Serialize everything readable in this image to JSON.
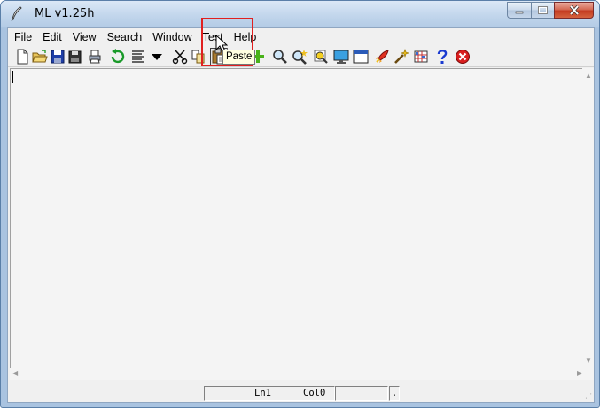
{
  "window": {
    "title": "ML v1.25h",
    "controls": {
      "minimize": "minimize-icon",
      "maximize": "maximize-icon",
      "close": "close-icon"
    }
  },
  "menu": [
    "File",
    "Edit",
    "View",
    "Search",
    "Window",
    "Test",
    "Help"
  ],
  "toolbar": {
    "buttons": [
      {
        "name": "new",
        "icon": "new-file-icon"
      },
      {
        "name": "open",
        "icon": "open-folder-icon"
      },
      {
        "name": "save",
        "icon": "save-icon"
      },
      {
        "name": "save-all",
        "icon": "save-all-icon"
      },
      {
        "name": "print",
        "icon": "print-icon"
      },
      {
        "name": "undo",
        "icon": "undo-icon"
      },
      {
        "name": "format",
        "icon": "text-lines-icon"
      },
      {
        "name": "dropdown",
        "icon": "triangle-down-icon"
      },
      {
        "name": "cut",
        "icon": "scissors-icon"
      },
      {
        "name": "copy",
        "icon": "copy-icon"
      },
      {
        "name": "paste",
        "icon": "paste-icon",
        "pressed": true
      },
      {
        "name": "zoom-out",
        "icon": "minus-icon"
      },
      {
        "name": "zoom-in",
        "icon": "plus-icon"
      },
      {
        "name": "find",
        "icon": "find-icon"
      },
      {
        "name": "find-next",
        "icon": "find-next-icon"
      },
      {
        "name": "highlight",
        "icon": "highlight-icon"
      },
      {
        "name": "display",
        "icon": "monitor-icon"
      },
      {
        "name": "window",
        "icon": "window-icon"
      },
      {
        "name": "run",
        "icon": "rocket-icon"
      },
      {
        "name": "wand",
        "icon": "magic-wand-icon"
      },
      {
        "name": "grid",
        "icon": "grid-icon"
      },
      {
        "name": "help",
        "icon": "question-icon"
      },
      {
        "name": "exit",
        "icon": "stop-icon"
      }
    ],
    "tooltip": "Paste"
  },
  "status": {
    "line_label": "Ln1",
    "col_label": "Col0",
    "blank": "",
    "dot": "."
  },
  "colors": {
    "highlight_box": "#e02020",
    "tooltip_bg": "#ffffe1",
    "close_button": "#c43b20"
  }
}
